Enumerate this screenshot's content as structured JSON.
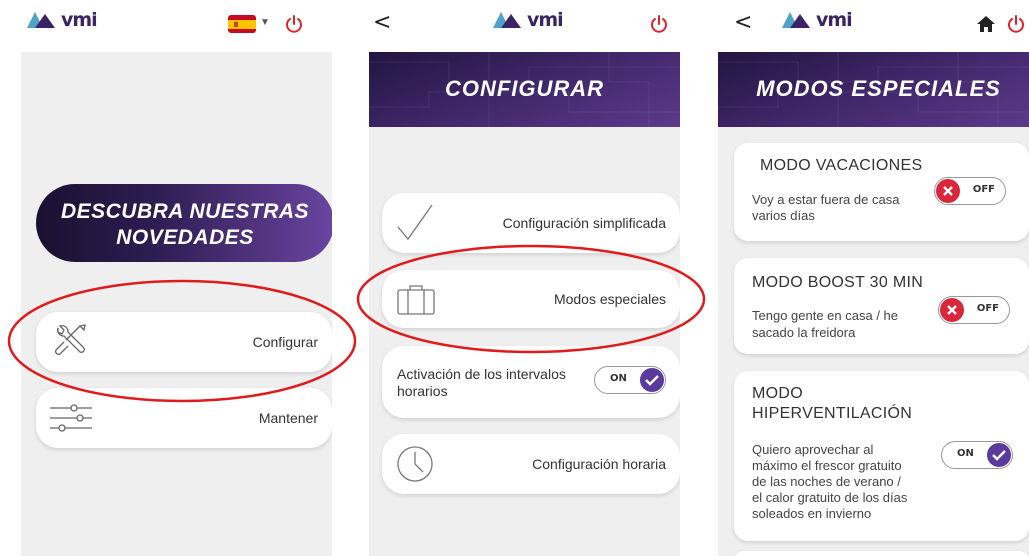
{
  "brand": {
    "logo_text": "vmi"
  },
  "screen1": {
    "promo_line1": "DESCUBRA NUESTRAS",
    "promo_line2": "NOVEDADES",
    "menu": [
      {
        "label": "Configurar",
        "icon": "tools-icon"
      },
      {
        "label": "Mantener",
        "icon": "sliders-icon"
      }
    ]
  },
  "screen2": {
    "title": "CONFIGURAR",
    "items": [
      {
        "label": "Configuración simplificada",
        "icon": "checkmark-icon"
      },
      {
        "label": "Modos especiales",
        "icon": "suitcase-icon"
      },
      {
        "label_line1": "Activación de los intervalos",
        "label_line2": "horarios",
        "toggle": "ON"
      },
      {
        "label": "Configuración horaria",
        "icon": "clock-icon"
      }
    ]
  },
  "screen3": {
    "title": "MODOS ESPECIALES",
    "cards": [
      {
        "title": "MODO VACACIONES",
        "desc_line1": "Voy a estar fuera de casa",
        "desc_line2": "varios días",
        "toggle": "OFF"
      },
      {
        "title": "MODO BOOST 30 MIN",
        "desc_line1": "Tengo gente en casa / he",
        "desc_line2": "sacado la freidora",
        "toggle": "OFF"
      },
      {
        "title_line1": "MODO",
        "title_line2": "HIPERVENTILACIÓN",
        "desc_lines": [
          "Quiero aprovechar al",
          "máximo el frescor gratuito",
          "de las noches de verano /",
          "el calor gratuito de los días",
          "soleados en invierno"
        ],
        "toggle": "ON"
      }
    ]
  },
  "colors": {
    "brand_purple": "#3b2466",
    "toggle_on": "#5b3a9e",
    "toggle_off": "#d9263a",
    "power_red": "#e0242f",
    "annotation_red": "#e01b1b"
  }
}
